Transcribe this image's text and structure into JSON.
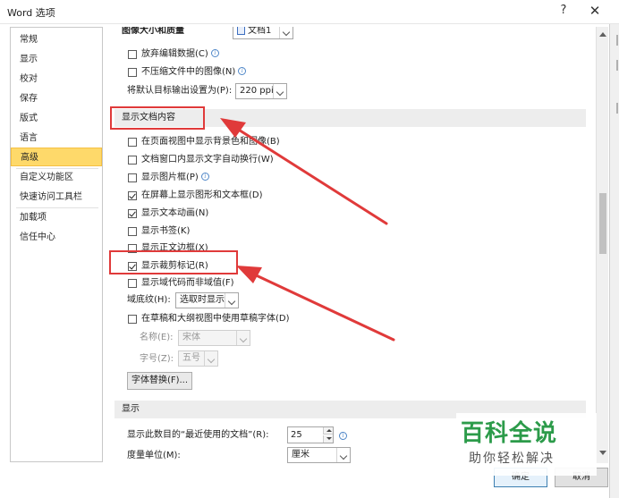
{
  "window": {
    "title": "Word 选项",
    "help_glyph": "?",
    "close_glyph": "✕"
  },
  "sidebar": {
    "items": [
      {
        "label": "常规"
      },
      {
        "label": "显示"
      },
      {
        "label": "校对"
      },
      {
        "label": "保存"
      },
      {
        "label": "版式"
      },
      {
        "label": "语言"
      },
      {
        "label": "高级",
        "active": true
      },
      {
        "label": "自定义功能区"
      },
      {
        "label": "快速访问工具栏"
      },
      {
        "label": "加载项"
      },
      {
        "label": "信任中心"
      }
    ]
  },
  "image_section": {
    "header": "图像大小和质量",
    "doc_combo": "文档1",
    "discard_edit": "放弃编辑数据(C)",
    "no_compress": "不压缩文件中的图像(N)",
    "default_res_label": "将默认目标输出设置为(P):",
    "default_res_value": "220 ppi"
  },
  "doc_content": {
    "header": "显示文档内容",
    "options": [
      {
        "label": "在页面视图中显示背景色和图像(B)",
        "checked": false
      },
      {
        "label": "文档窗口内显示文字自动换行(W)",
        "checked": false
      },
      {
        "label": "显示图片框(P)",
        "checked": false,
        "info": true
      },
      {
        "label": "在屏幕上显示图形和文本框(D)",
        "checked": true
      },
      {
        "label": "显示文本动画(N)",
        "checked": true
      },
      {
        "label": "显示书签(K)",
        "checked": false
      },
      {
        "label": "显示正文边框(X)",
        "checked": false
      },
      {
        "label": "显示裁剪标记(R)",
        "checked": true
      },
      {
        "label": "显示域代码而非域值(F)",
        "checked": false
      }
    ],
    "field_shading_label": "域底纹(H):",
    "field_shading_value": "选取时显示",
    "draft_font": "在草稿和大纲视图中使用草稿字体(D)",
    "font_name_label": "名称(E):",
    "font_name_value": "宋体",
    "font_size_label": "字号(Z):",
    "font_size_value": "五号",
    "font_substitution": "字体替换(F)..."
  },
  "display_section": {
    "header": "显示",
    "recent_docs_label": "显示此数目的“最近使用的文档”(R):",
    "recent_docs_value": "25",
    "measure_label": "度量单位(M):",
    "measure_value": "厘米"
  },
  "footer": {
    "ok": "确定",
    "cancel": "取消"
  },
  "watermark": {
    "main": "百科全说",
    "sub": "助你轻松解决"
  },
  "colors": {
    "active_nav": "#fed96a",
    "annotation_red": "#e03a3a",
    "watermark_green": "#2c9b4a"
  }
}
